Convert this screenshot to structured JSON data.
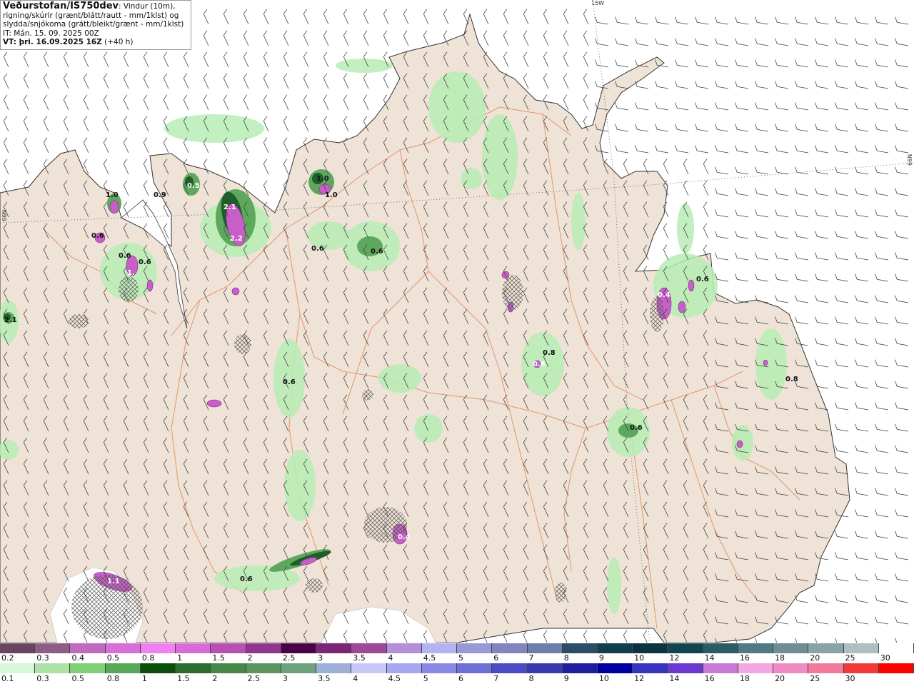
{
  "header": {
    "title": "Veðurstofan/IS750dev",
    "desc_1": ": Vindur (10m),",
    "desc_2": "rigning/skúrir (grænt/blátt/rautt - mm/1klst) og",
    "desc_3": "slydda/snjókoma (grátt/bleikt/grænt - mm/1klst)",
    "it": "IT: Mán. 15. 09. 2025 00Z",
    "vt_bold": "VT: þri. 16.09.2025 16Z",
    "vt_rest": " (+40 h)"
  },
  "graticule": {
    "lon_label": "15W",
    "lat_label_left": "66N",
    "lat_label_right": "66N"
  },
  "colors": {
    "sea": "#ffffff",
    "land": "#efe2d6",
    "roads": "#e08a5a",
    "coast": "#333333",
    "wind_barbs": "#444444"
  },
  "precip_labels": [
    {
      "v": "1.0"
    },
    {
      "v": "1.0"
    },
    {
      "v": "0.9"
    },
    {
      "v": "0.5"
    },
    {
      "v": "2.1"
    },
    {
      "v": "2.2"
    },
    {
      "v": "1.0"
    },
    {
      "v": "0.6"
    },
    {
      "v": "0.6"
    },
    {
      "v": "0.4"
    },
    {
      "v": "0.6"
    },
    {
      "v": "1."
    },
    {
      "v": "0.6"
    },
    {
      "v": "0.8"
    },
    {
      "v": "0.6"
    },
    {
      "v": "0.6"
    },
    {
      "v": "0.8"
    },
    {
      "v": "0.6"
    },
    {
      "v": "0.4"
    },
    {
      "v": "2.1"
    },
    {
      "v": "0.6"
    },
    {
      "v": "1.1"
    },
    {
      "v": "0.8"
    },
    {
      "v": "0.6"
    }
  ],
  "scale_snow": {
    "labels": [
      "0.2",
      "0.3",
      "0.4",
      "0.5",
      "0.8",
      "1",
      "1.5",
      "2",
      "2.5",
      "3",
      "3.5",
      "4",
      "4.5",
      "5",
      "6",
      "7",
      "8",
      "9",
      "10",
      "12",
      "14",
      "16",
      "18",
      "20",
      "25",
      "30"
    ],
    "colors": [
      "#6b4560",
      "#8e5d86",
      "#c06ac0",
      "#d76fd7",
      "#f27ff2",
      "#d96ad8",
      "#b74fb4",
      "#92358f",
      "#480048",
      "#7a2576",
      "#9c4a98",
      "#b58fd9",
      "#b3b3ef",
      "#9999d8",
      "#8484bf",
      "#6c7eaa",
      "#2d4d66",
      "#103f4f",
      "#0b3340",
      "#104550",
      "#2b5c66",
      "#4f7a82",
      "#6e8e93",
      "#8aa3a8",
      "#aebfc2",
      "#ffffff"
    ]
  },
  "scale_rain": {
    "labels": [
      "0.1",
      "0.3",
      "0.5",
      "0.8",
      "1",
      "1.5",
      "2",
      "2.5",
      "3",
      "3.5",
      "4",
      "4.5",
      "5",
      "6",
      "7",
      "8",
      "9",
      "10",
      "12",
      "14",
      "16",
      "18",
      "20",
      "25",
      "30"
    ],
    "colors": [
      "#d8f6d8",
      "#aee3a8",
      "#7fcf77",
      "#57a857",
      "#0b4f0b",
      "#2e6b2e",
      "#478747",
      "#5c9560",
      "#6ea27c",
      "#9fb0d8",
      "#c8c8f6",
      "#a8a8f0",
      "#8a8ae6",
      "#6f6fd8",
      "#4b4bc6",
      "#3a3ab0",
      "#1e1ea0",
      "#0000a0",
      "#3535c0",
      "#6a3ad0",
      "#c87ad8",
      "#f3a8e2",
      "#f08cc4",
      "#f27a9a",
      "#f23a3a",
      "#ff0000"
    ]
  }
}
